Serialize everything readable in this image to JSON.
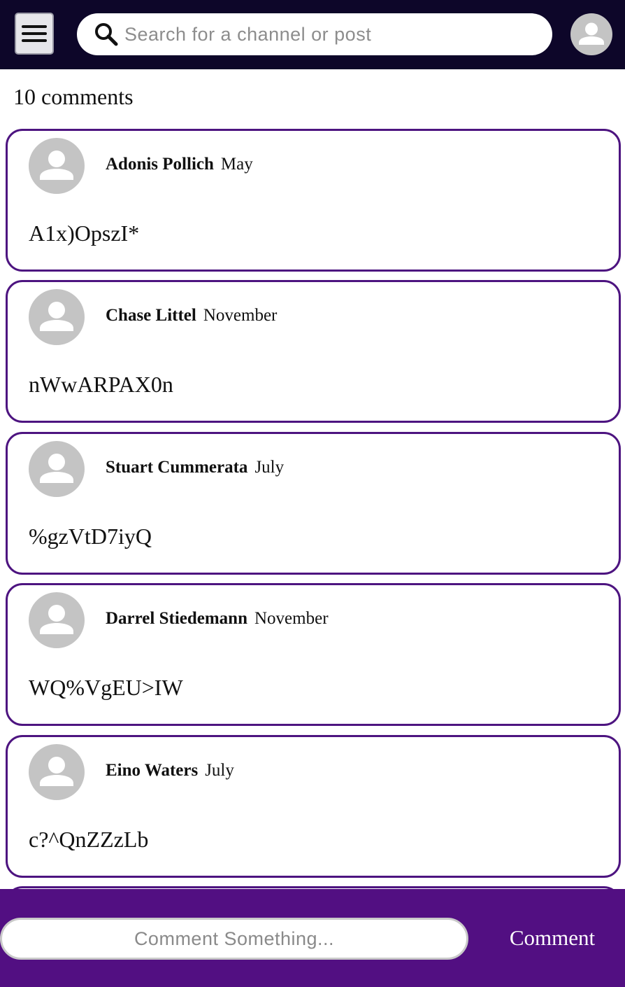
{
  "header": {
    "menu_icon": "hamburger-menu-icon",
    "search_icon": "magnifier-icon",
    "search_placeholder": "Search for a channel or post",
    "search_value": "",
    "profile_icon": "user-avatar-icon"
  },
  "comments": {
    "count_label": "10 comments",
    "items": [
      {
        "author": "Adonis Pollich",
        "date": "May",
        "text": "A1x)OpszI*"
      },
      {
        "author": "Chase Littel",
        "date": "November",
        "text": "nWwARPAX0n"
      },
      {
        "author": "Stuart Cummerata",
        "date": "July",
        "text": "%gzVtD7iyQ"
      },
      {
        "author": "Darrel Stiedemann",
        "date": "November",
        "text": "WQ%VgEU>IW"
      },
      {
        "author": "Eino Waters",
        "date": "July",
        "text": "c?^QnZZzLb"
      }
    ]
  },
  "composer": {
    "placeholder": "Comment Something...",
    "value": "",
    "submit_label": "Comment"
  },
  "colors": {
    "header_bg": "#0d0629",
    "accent_purple": "#520f82",
    "card_border": "#4d1480",
    "avatar_gray": "#c4c4c4"
  }
}
